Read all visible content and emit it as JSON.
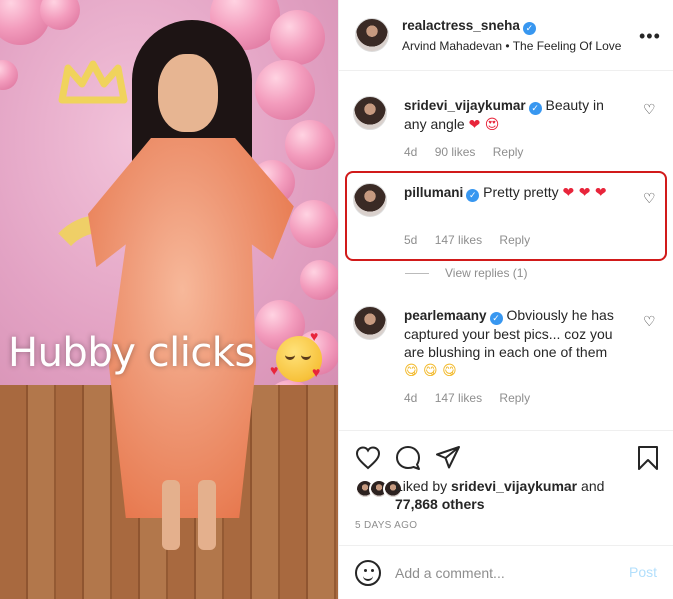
{
  "photo": {
    "caption": "Hubby clicks",
    "emoji": "smiling-face-with-hearts"
  },
  "post": {
    "username": "realactress_sneha",
    "subtitle": "Arvind Mahadevan • The Feeling Of Love",
    "more": "•••"
  },
  "comments": [
    {
      "username": "sridevi_vijaykumar",
      "text": "Beauty in any angle",
      "emoji": "❤ 😍",
      "age": "4d",
      "likes": "90 likes",
      "reply": "Reply"
    },
    {
      "username": "pillumani",
      "text": "Pretty pretty",
      "emoji": "❤ ❤ ❤",
      "age": "5d",
      "likes": "147 likes",
      "reply": "Reply",
      "view_replies": "View replies (1)"
    },
    {
      "username": "pearlemaany",
      "text": "Obviously he has captured your best pics... coz you are blushing in each one of them",
      "emoji": "😋 😋 😋",
      "age": "4d",
      "likes": "147 likes",
      "reply": "Reply"
    }
  ],
  "likes": {
    "prefix": "Liked by",
    "user": "sridevi_vijaykumar",
    "joiner": "and",
    "others": "77,868 others"
  },
  "timestamp": "5 DAYS AGO",
  "composer": {
    "placeholder": "Add a comment...",
    "post_label": "Post"
  },
  "colors": {
    "verified": "#3897f0",
    "highlight": "#d11a1a",
    "meta": "#8e8e8e",
    "post_disabled": "#b2dffc"
  }
}
